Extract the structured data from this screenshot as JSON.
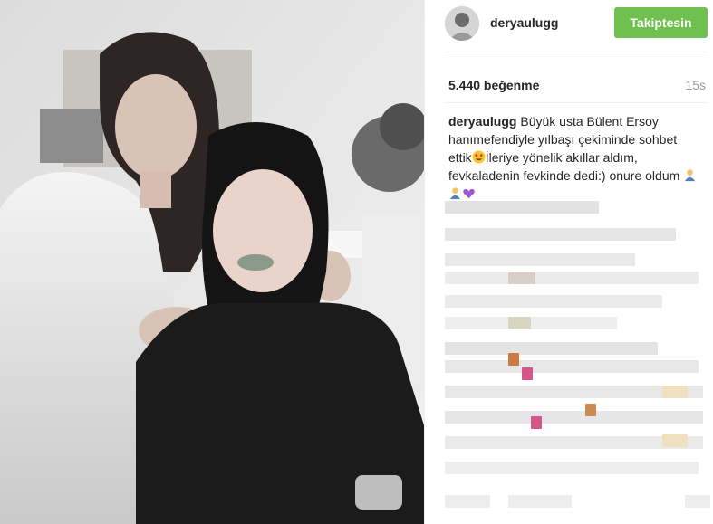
{
  "post": {
    "username": "deryaulugg",
    "follow_label": "Takiptesin",
    "likes": "5.440 beğenme",
    "time_ago": "15s",
    "caption_user": "deryaulugg",
    "caption_part1": "Büyük usta Bülent Ersoy hanımefendiyle yılbaşı çekiminde sohbet ettik",
    "caption_part2": "İleriye yönelik akıllar aldım, fevkaladenin fevkinde dedi:) onure oldum",
    "caption_emojis": [
      "heart-eyes-emoji",
      "person-bowing-emoji",
      "person-bowing-emoji",
      "purple-heart-emoji"
    ]
  },
  "colors": {
    "follow_bg": "#70c050",
    "text": "#262626",
    "muted": "#999999",
    "divider": "#efefef"
  }
}
